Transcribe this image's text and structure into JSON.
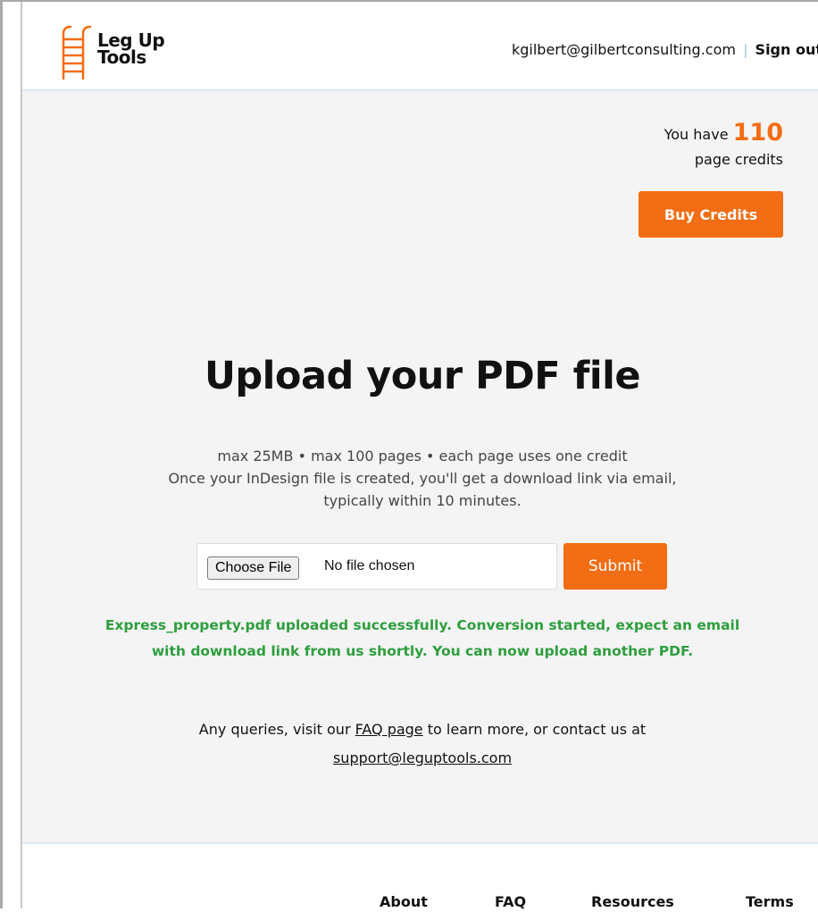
{
  "header": {
    "logo_line1": "Leg Up",
    "logo_line2": "Tools",
    "user_email": "kgilbert@gilbertconsulting.com",
    "separator": "|",
    "sign_out_label": "Sign out"
  },
  "credits": {
    "prefix": "You have",
    "count": "110",
    "suffix": "page credits",
    "buy_label": "Buy Credits"
  },
  "upload": {
    "title": "Upload your PDF file",
    "info_line1": "max 25MB • max 100 pages • each page uses one credit",
    "info_line2": "Once your InDesign file is created, you'll get a download link via email,",
    "info_line3": "typically within 10 minutes.",
    "choose_file_label": "Choose File",
    "no_file_text": "No file chosen",
    "submit_label": "Submit",
    "success_line1": "Express_property.pdf uploaded successfully. Conversion started, expect an email",
    "success_line2": "with download link from us shortly. You can now upload another PDF."
  },
  "queries": {
    "text_before": "Any queries, visit our",
    "faq_link": "FAQ page",
    "text_after": "to learn more, or contact us at",
    "support_email": "support@leguptools.com"
  },
  "footer": {
    "links": [
      "About",
      "FAQ",
      "Resources",
      "Terms"
    ]
  },
  "colors": {
    "accent": "#f26d13",
    "success": "#2e9e3e"
  }
}
